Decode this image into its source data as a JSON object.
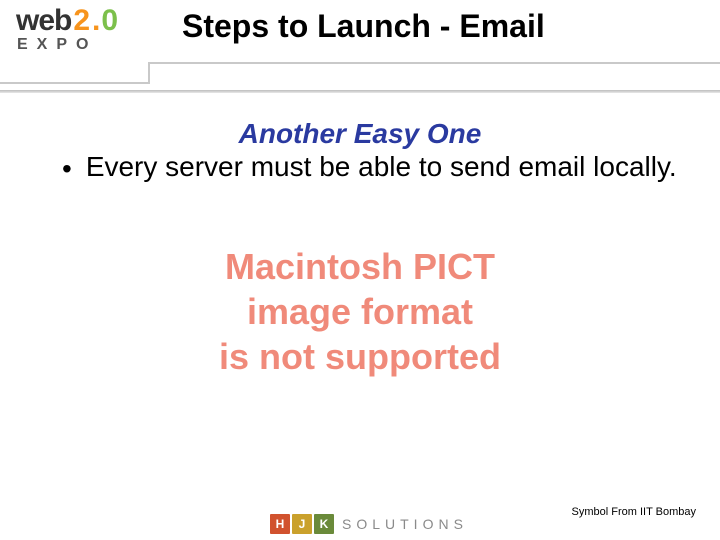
{
  "logo": {
    "word_web": "web",
    "word_2": "2",
    "dot": ".",
    "word_0": "0",
    "expo": "EXPO"
  },
  "title": "Steps to Launch - Email",
  "subtitle": "Another Easy One",
  "bullets": [
    "Every server must be able to send email locally."
  ],
  "placeholder_lines": [
    "Macintosh PICT",
    "image format",
    "is not supported"
  ],
  "footer": {
    "tile_h": "H",
    "tile_j": "J",
    "tile_k": "K",
    "solutions": "SOLUTIONS",
    "credit": "Symbol From IIT Bombay"
  }
}
